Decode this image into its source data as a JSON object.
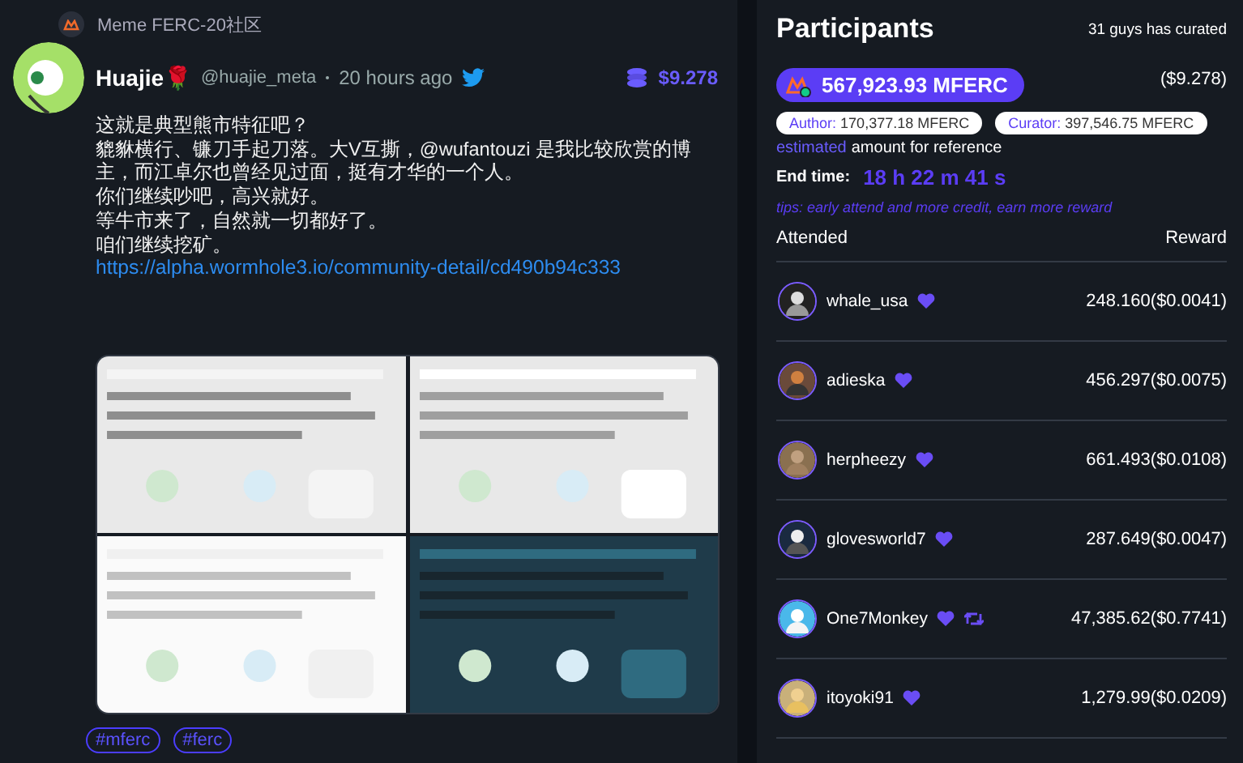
{
  "community": {
    "name": "Meme FERC-20社区"
  },
  "post": {
    "author": "Huajie🌹",
    "handle": "@huajie_meta",
    "time": "20 hours ago",
    "reward": "$9.278",
    "lines": [
      "这就是典型熊市特征吧？",
      "貔貅横行、镰刀手起刀落。大V互撕，@wufantouzi 是我比较欣赏的博主，而江卓尔也曾经见过面，挺有才华的一个人。",
      "你们继续吵吧，高兴就好。",
      "等牛市来了，自然就一切都好了。",
      "咱们继续挖矿。"
    ],
    "link": "https://alpha.wormhole3.io/community-detail/cd490b94c333",
    "images": [
      {
        "kind": "picture"
      },
      {
        "kind": "picture"
      },
      {
        "kind": "picture"
      },
      {
        "kind": "picture"
      }
    ],
    "tags": [
      "#mferc",
      "#ferc"
    ]
  },
  "participants": {
    "title": "Participants",
    "curated": "31 guys has curated",
    "total": "567,923.93 MFERC",
    "total_usd": "($9.278)",
    "author_label": "Author:",
    "author_amount": "170,377.18 MFERC",
    "curator_label": "Curator:",
    "curator_amount": "397,546.75 MFERC",
    "estimated": "estimated",
    "reference": "amount for reference",
    "end_label": "End time:",
    "end_value": "18 h 22 m 41 s",
    "tips": "tips: early attend and more credit, earn more reward",
    "columns": [
      "Attended",
      "Reward"
    ],
    "rows": [
      {
        "name": "whale_usa",
        "retweeted": false,
        "reward": "248.160($0.0041)"
      },
      {
        "name": "adieska",
        "retweeted": false,
        "reward": "456.297($0.0075)"
      },
      {
        "name": "herpheezy",
        "retweeted": false,
        "reward": "661.493($0.0108)"
      },
      {
        "name": "glovesworld7",
        "retweeted": false,
        "reward": "287.649($0.0047)"
      },
      {
        "name": "One7Monkey",
        "retweeted": true,
        "reward": "47,385.62($0.7741)"
      },
      {
        "name": "itoyoki91",
        "retweeted": false,
        "reward": "1,279.99($0.0209)"
      }
    ]
  }
}
